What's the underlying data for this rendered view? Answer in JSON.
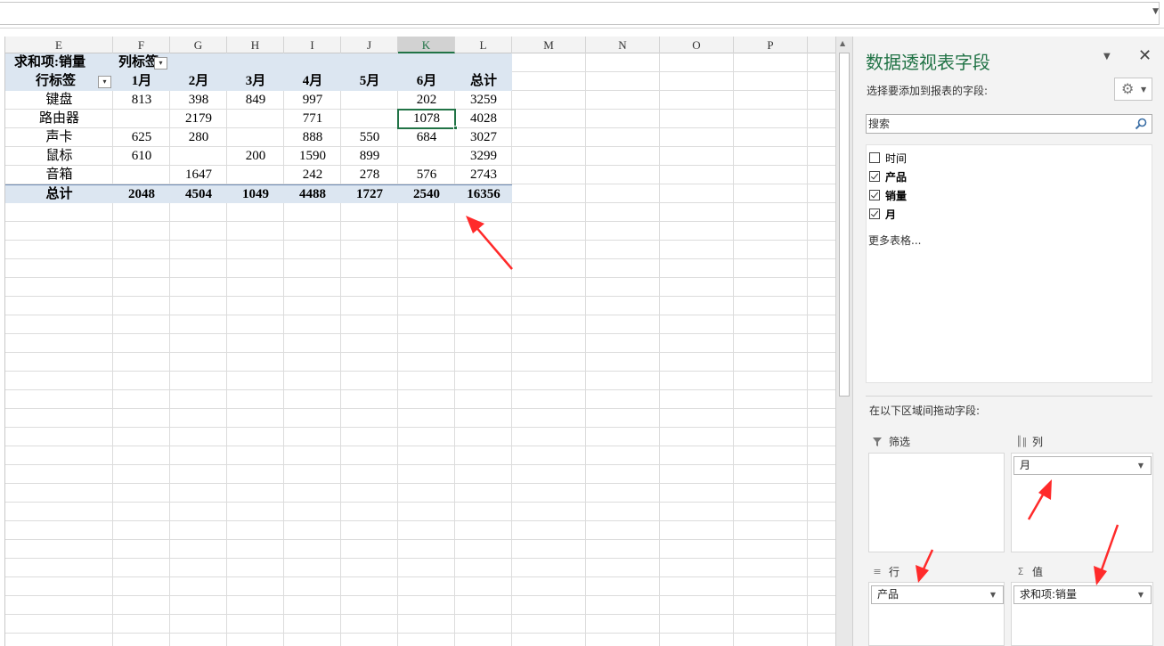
{
  "formula_bar": {
    "value": ""
  },
  "columns": [
    {
      "label": "E",
      "selected": false
    },
    {
      "label": "F",
      "selected": false
    },
    {
      "label": "G",
      "selected": false
    },
    {
      "label": "H",
      "selected": false
    },
    {
      "label": "I",
      "selected": false
    },
    {
      "label": "J",
      "selected": false
    },
    {
      "label": "K",
      "selected": true
    },
    {
      "label": "L",
      "selected": false
    },
    {
      "label": "M",
      "selected": false
    },
    {
      "label": "N",
      "selected": false
    },
    {
      "label": "O",
      "selected": false
    },
    {
      "label": "P",
      "selected": false
    }
  ],
  "pivot": {
    "value_label": "求和项:销量",
    "col_label": "列标签",
    "row_label": "行标签",
    "months": [
      "1月",
      "2月",
      "3月",
      "4月",
      "5月",
      "6月"
    ],
    "total_label": "总计",
    "rows": [
      {
        "name": "键盘",
        "values": [
          "813",
          "398",
          "849",
          "997",
          "",
          "202"
        ],
        "total": "3259"
      },
      {
        "name": "路由器",
        "values": [
          "",
          "2179",
          "",
          "771",
          "",
          "1078"
        ],
        "total": "4028"
      },
      {
        "name": "声卡",
        "values": [
          "625",
          "280",
          "",
          "888",
          "550",
          "684"
        ],
        "total": "3027"
      },
      {
        "name": "鼠标",
        "values": [
          "610",
          "",
          "200",
          "1590",
          "899",
          ""
        ],
        "total": "3299"
      },
      {
        "name": "音箱",
        "values": [
          "",
          "1647",
          "",
          "242",
          "278",
          "576"
        ],
        "total": "2743"
      }
    ],
    "grand_total": {
      "name": "总计",
      "values": [
        "2048",
        "4504",
        "1049",
        "4488",
        "1727",
        "2540"
      ],
      "total": "16356"
    }
  },
  "pane": {
    "title": "数据透视表字段",
    "subtitle": "选择要添加到报表的字段:",
    "search_placeholder": "搜索",
    "fields": [
      {
        "label": "时间",
        "checked": false
      },
      {
        "label": "产品",
        "checked": true
      },
      {
        "label": "销量",
        "checked": true
      },
      {
        "label": "月",
        "checked": true
      }
    ],
    "more_tables": "更多表格...",
    "drag_hint": "在以下区域间拖动字段:",
    "areas": {
      "filter": {
        "label": "筛选",
        "icon": "filter-icon",
        "pill": ""
      },
      "columns": {
        "label": "列",
        "icon": "columns-icon",
        "pill": "月"
      },
      "rows": {
        "label": "行",
        "icon": "rows-icon",
        "pill": "产品"
      },
      "values": {
        "label": "值",
        "icon": "sigma-icon",
        "pill": "求和项:销量"
      }
    }
  },
  "colors": {
    "accent": "#217346",
    "pivot_header_bg": "#dce6f1",
    "arrow": "#ff2a2a"
  }
}
